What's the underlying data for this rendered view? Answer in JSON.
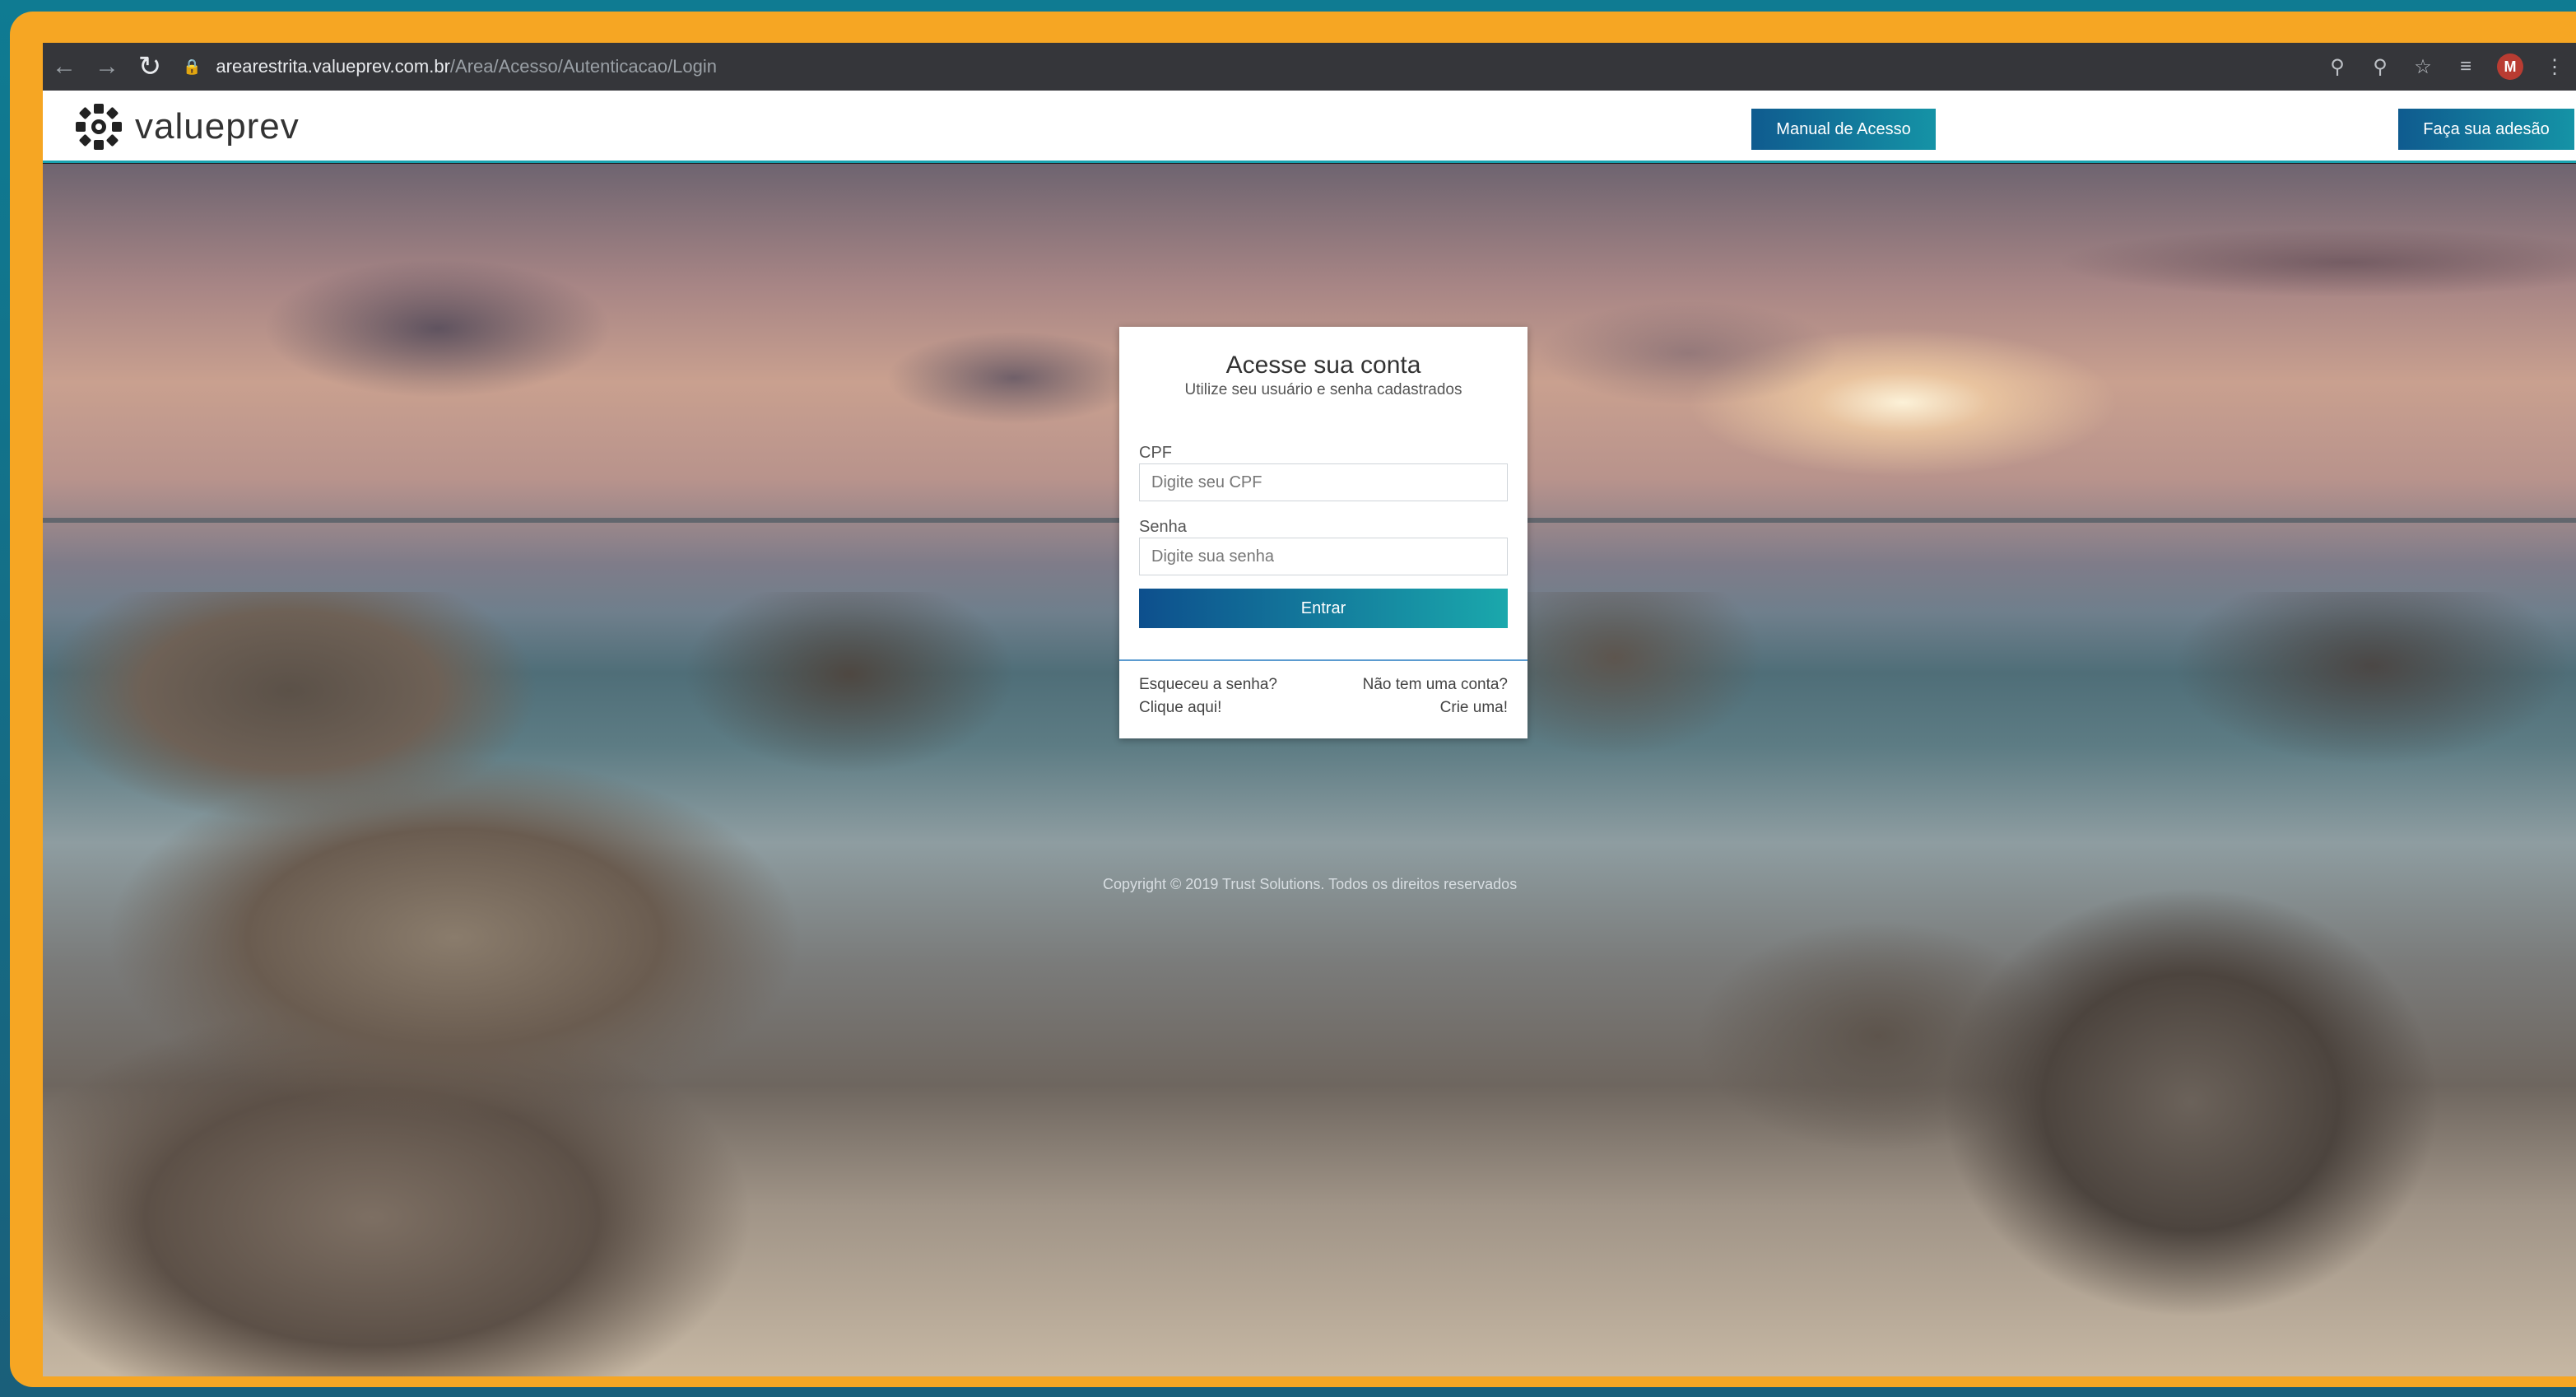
{
  "browser": {
    "url_host": "arearestrita.valueprev.com.br",
    "url_path": "/Area/Acesso/Autenticacao/Login",
    "profile_initial": "M"
  },
  "header": {
    "logo_text": "valueprev",
    "manual_button": "Manual de Acesso",
    "adesao_button": "Faça sua adesão"
  },
  "login": {
    "title": "Acesse sua conta",
    "subtitle": "Utilize seu usuário e senha cadastrados",
    "cpf_label": "CPF",
    "cpf_placeholder": "Digite seu CPF",
    "senha_label": "Senha",
    "senha_placeholder": "Digite sua senha",
    "submit_button": "Entrar",
    "forgot_question": "Esqueceu a senha?",
    "forgot_link": "Clique aqui!",
    "signup_question": "Não tem uma conta?",
    "signup_link": "Crie uma!"
  },
  "footer": {
    "copyright": "Copyright © 2019 Trust Solutions. Todos os direitos reservados"
  },
  "colors": {
    "accent_start": "#0f5b8f",
    "accent_end": "#1593a6",
    "frame_orange": "#f6a623",
    "frame_teal": "#0f7b92"
  }
}
